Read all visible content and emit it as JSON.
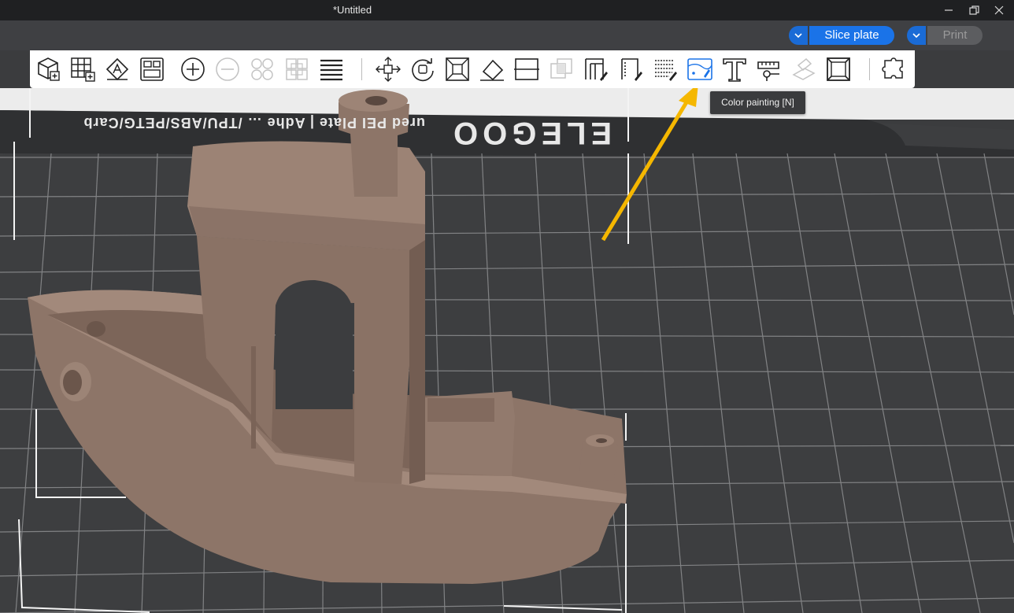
{
  "window": {
    "title": "*Untitled",
    "minimize_icon": "minimize-icon",
    "restore_icon": "restore-icon",
    "close_icon": "close-icon"
  },
  "topbar": {
    "slice_label": "Slice plate",
    "print_label": "Print",
    "accent_color": "#1a73e8"
  },
  "toolbar": {
    "tools": [
      "add-object",
      "add-plate",
      "auto-orient",
      "arrange",
      "add-instance",
      "remove-instance",
      "split-objects",
      "split-parts",
      "layers-variable-height",
      "move",
      "rotate",
      "scale",
      "lay-on-face",
      "cut",
      "boolean",
      "support-painting",
      "seam-painting",
      "fuzzy-skin",
      "color-painting",
      "text",
      "measure",
      "assembly",
      "cut-connectors",
      "hollow"
    ],
    "tooltip": "Color painting [N]"
  },
  "plate": {
    "bed_text": "ured PEI Plate  |  Adhe  …  /TPU/ABS/PETG/Carb",
    "brand_text": "ELEGOO"
  }
}
